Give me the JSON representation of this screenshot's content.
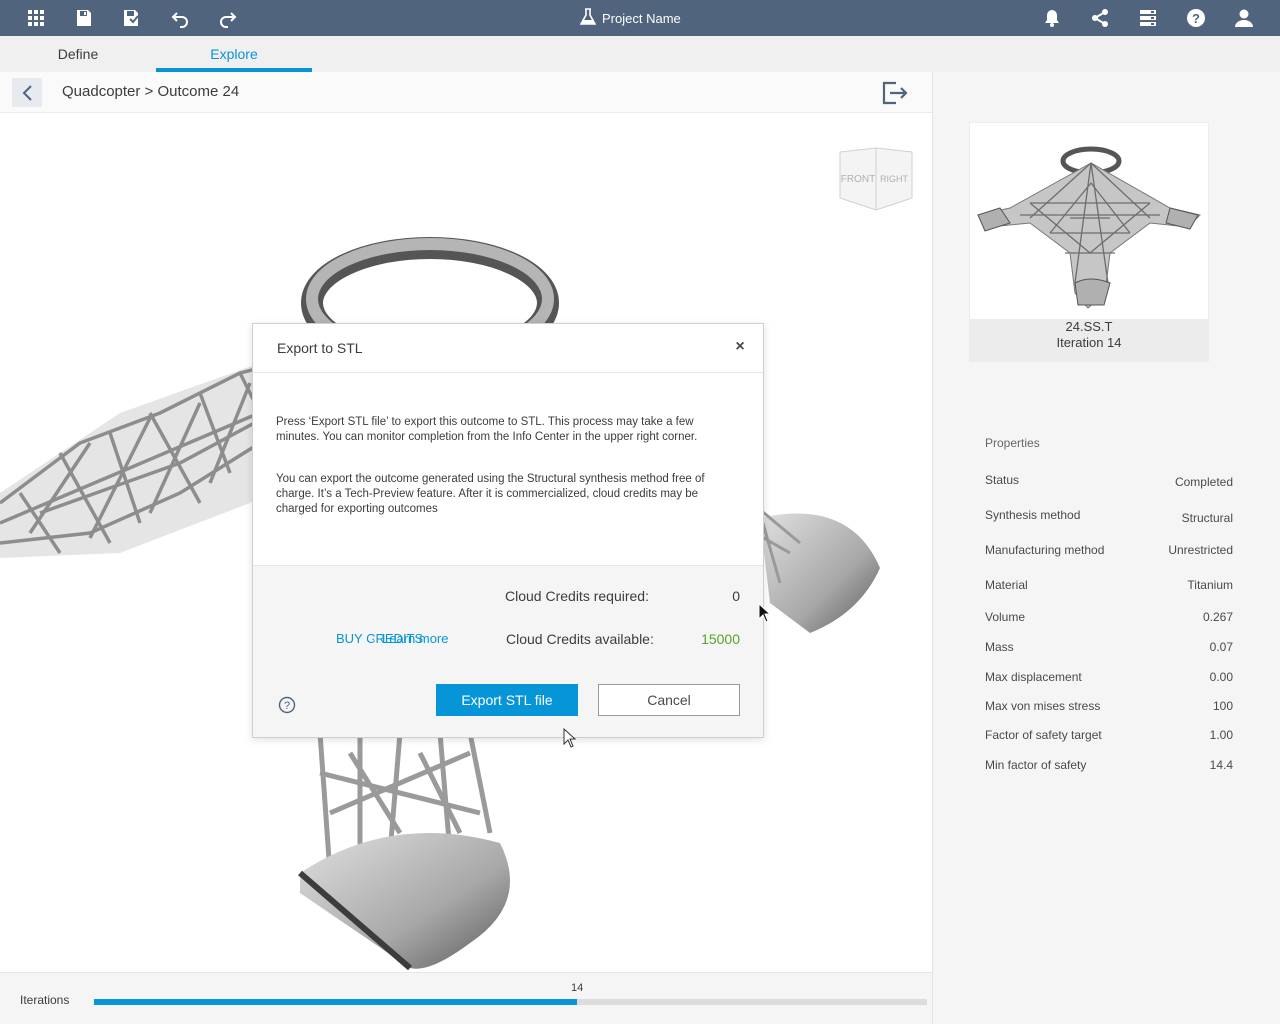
{
  "topbar": {
    "project_name": "Project Name",
    "icons": [
      "apps-grid-icon",
      "save-icon",
      "save-as-icon",
      "undo-icon",
      "redo-icon",
      "flask-icon",
      "bell-icon",
      "share-icon",
      "server-icon",
      "help-icon",
      "user-icon"
    ]
  },
  "tabs": [
    {
      "label": "Define",
      "active": false
    },
    {
      "label": "Explore",
      "active": true
    }
  ],
  "breadcrumb": "Quadcopter > Outcome 24",
  "viewcube": {
    "front": "FRONT",
    "right": "RIGHT"
  },
  "iterations": {
    "label": "Iterations",
    "value": "14",
    "progress": 0.58
  },
  "outcome_card": {
    "title": "24.SS.T",
    "subtitle": "Iteration 14"
  },
  "properties": {
    "heading": "Properties",
    "rows": [
      {
        "label": "Status",
        "value": "Completed"
      },
      {
        "label": "Synthesis method",
        "value": "Structural"
      },
      {
        "label": "Manufacturing method",
        "value": "Unrestricted"
      },
      {
        "label": "Material",
        "value": "Titanium"
      },
      {
        "label": "Volume",
        "value": "0.267"
      },
      {
        "label": "Mass",
        "value": "0.07"
      },
      {
        "label": "Max displacement",
        "value": "0.00"
      },
      {
        "label": "Max von mises stress",
        "value": "100"
      },
      {
        "label": "Factor of safety target",
        "value": "1.00"
      },
      {
        "label": "Min factor of safety",
        "value": "14.4"
      }
    ]
  },
  "dialog": {
    "title": "Export to STL",
    "close_label": "×",
    "paragraph1": "Press ‘Export STL file’ to export this outcome to STL. This process may take a few minutes. You can monitor completion from the Info Center in the upper right corner.",
    "paragraph2": "You can export the outcome generated using the Structural synthesis method free of charge. It’s a Tech-Preview feature. After it is commercialized, cloud credits may be charged for exporting outcomes",
    "credits_required_label": "Cloud Credits required:",
    "credits_required_value": "0",
    "credits_available_label": "Cloud Credits available:",
    "credits_available_value": "15000",
    "buy_link": "BUY CREDITS",
    "learn_more_link": "Learn more",
    "link_separator": "·",
    "export_button": "Export STL file",
    "cancel_button": "Cancel",
    "colors": {
      "accent": "#0696d7",
      "available": "#5aa22a"
    }
  }
}
